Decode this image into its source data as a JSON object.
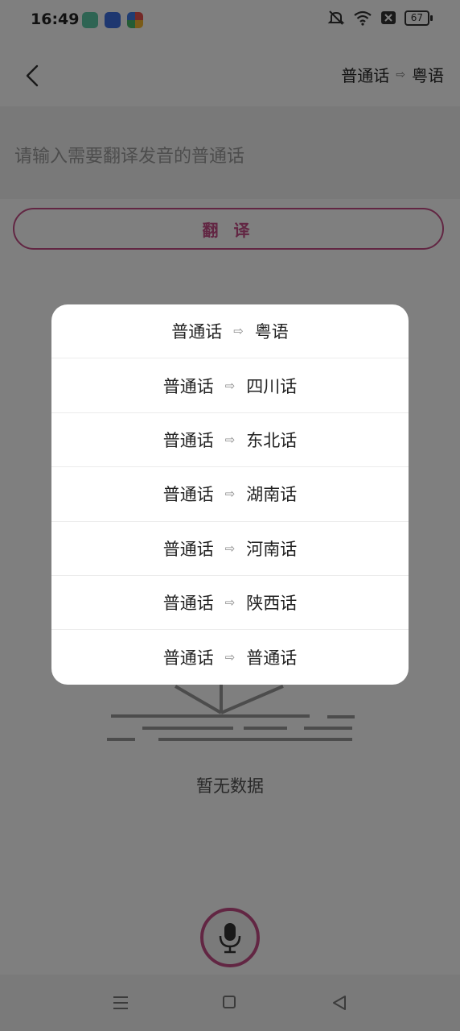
{
  "status_bar": {
    "time": "16:49",
    "battery": "67"
  },
  "app_bar": {
    "source_lang": "普通话",
    "arrow": "⇨",
    "target_lang": "粤语"
  },
  "input": {
    "placeholder": "请输入需要翻译发音的普通话"
  },
  "translate_button": "翻 译",
  "empty_state": {
    "text": "暂无数据"
  },
  "dialog": {
    "options": [
      {
        "from": "普通话",
        "arrow": "⇨",
        "to": "粤语"
      },
      {
        "from": "普通话",
        "arrow": "⇨",
        "to": "四川话"
      },
      {
        "from": "普通话",
        "arrow": "⇨",
        "to": "东北话"
      },
      {
        "from": "普通话",
        "arrow": "⇨",
        "to": "湖南话"
      },
      {
        "from": "普通话",
        "arrow": "⇨",
        "to": "河南话"
      },
      {
        "from": "普通话",
        "arrow": "⇨",
        "to": "陕西话"
      },
      {
        "from": "普通话",
        "arrow": "⇨",
        "to": "普通话"
      }
    ]
  },
  "colors": {
    "accent": "#c44d86",
    "overlay": "rgba(0,0,0,0.5)"
  },
  "icons": [
    "back-icon",
    "microphone-icon",
    "wifi-icon",
    "mute-icon",
    "battery-icon",
    "nav-menu-icon",
    "nav-home-icon",
    "nav-back-icon"
  ]
}
